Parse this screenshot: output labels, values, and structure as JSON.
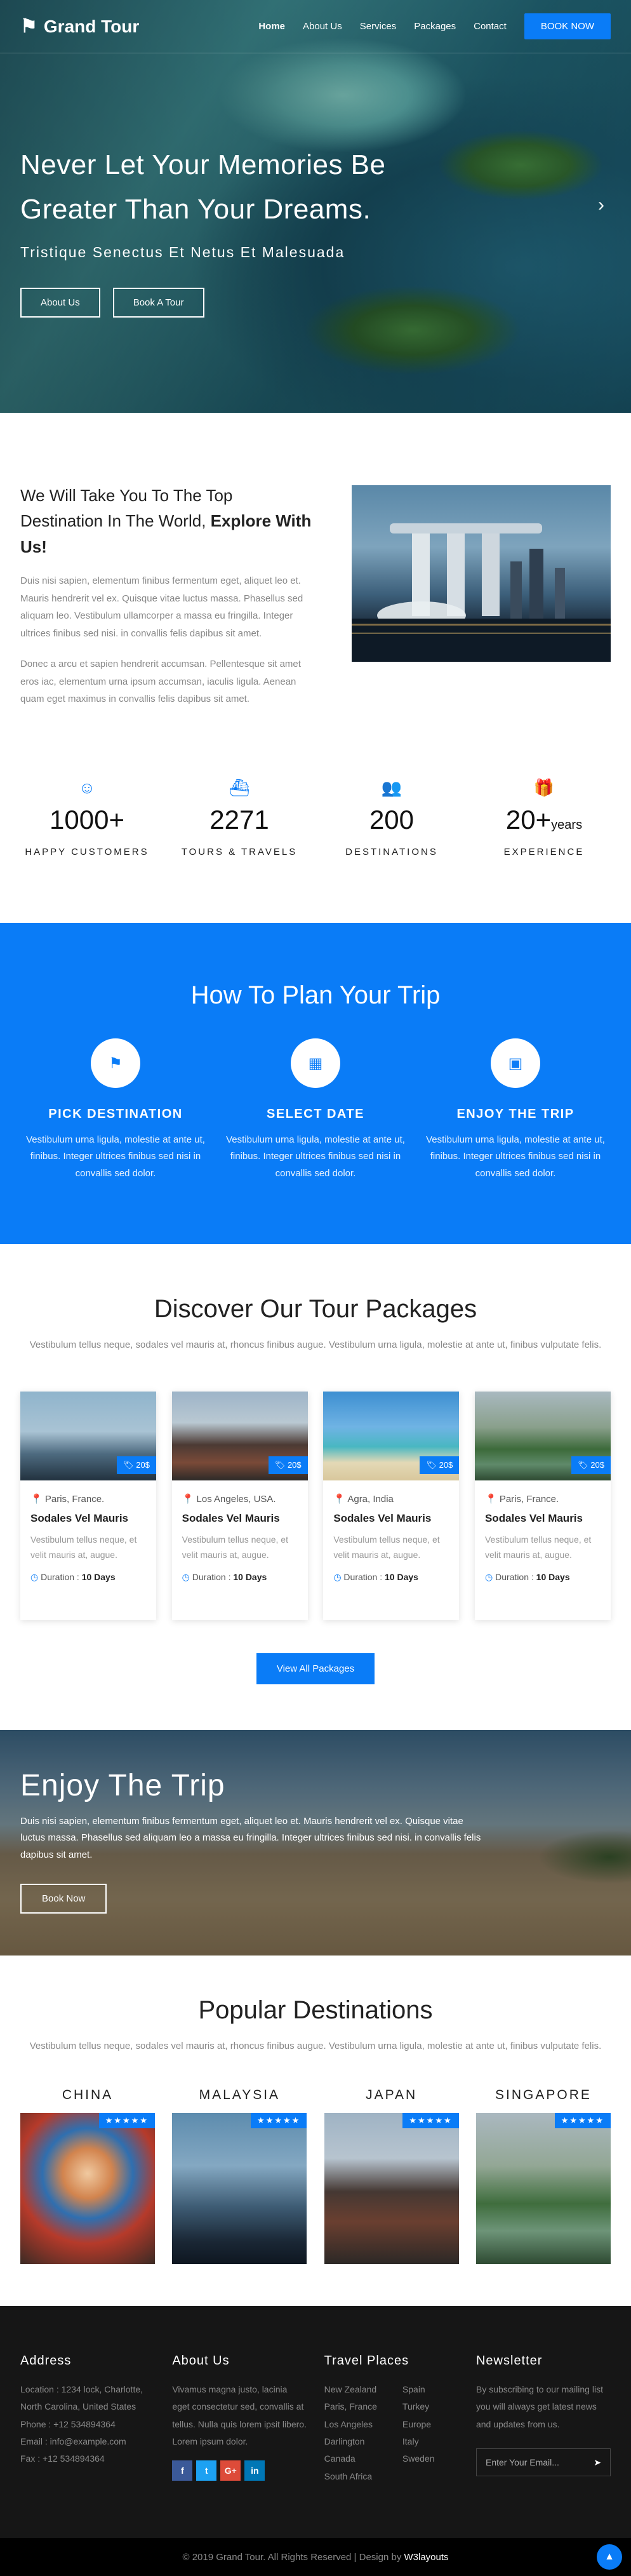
{
  "nav": {
    "brand": "Grand Tour",
    "links": [
      "Home",
      "About Us",
      "Services",
      "Packages",
      "Contact"
    ],
    "book_label": "BOOK NOW"
  },
  "hero": {
    "title_line1": "Never Let Your Memories Be",
    "title_line2": "Greater Than Your Dreams.",
    "subtitle": "Tristique Senectus Et Netus Et Malesuada",
    "about_btn": "About Us",
    "book_btn": "Book A Tour",
    "arrow": "›"
  },
  "about": {
    "heading": "We Will Take You To The Top Destination In The World,",
    "heading_bold": "Explore With Us!",
    "para1": "Duis nisi sapien, elementum finibus fermentum eget, aliquet leo et. Mauris hendrerit vel ex. Quisque vitae luctus massa. Phasellus sed aliquam leo. Vestibulum ullamcorper a massa eu fringilla. Integer ultrices finibus sed nisi. in convallis felis dapibus sit amet.",
    "para2": "Donec a arcu et sapien hendrerit accumsan. Pellentesque sit amet eros iac, elementum urna ipsum accumsan, iaculis ligula. Aenean quam eget maximus in convallis felis dapibus sit amet."
  },
  "stats": [
    {
      "icon": "☺",
      "value": "1000+",
      "suffix": "",
      "label": "HAPPY CUSTOMERS"
    },
    {
      "icon": "⛴",
      "value": "2271",
      "suffix": "",
      "label": "TOURS & TRAVELS"
    },
    {
      "icon": "👥",
      "value": "200",
      "suffix": "",
      "label": "DESTINATIONS"
    },
    {
      "icon": "🎁",
      "value": "20+",
      "suffix": "years",
      "label": "EXPERIENCE"
    }
  ],
  "plan": {
    "title": "How To Plan Your Trip",
    "steps": [
      {
        "icon": "⚑",
        "title": "PICK DESTINATION",
        "text": "Vestibulum urna ligula, molestie at ante ut, finibus. Integer ultrices finibus sed nisi in convallis sed dolor."
      },
      {
        "icon": "▦",
        "title": "SELECT DATE",
        "text": "Vestibulum urna ligula, molestie at ante ut, finibus. Integer ultrices finibus sed nisi in convallis sed dolor."
      },
      {
        "icon": "▣",
        "title": "ENJOY THE TRIP",
        "text": "Vestibulum urna ligula, molestie at ante ut, finibus. Integer ultrices finibus sed nisi in convallis sed dolor."
      }
    ]
  },
  "packages": {
    "title": "Discover Our Tour Packages",
    "subtitle": "Vestibulum tellus neque, sodales vel mauris at, rhoncus finibus augue. Vestibulum urna ligula, molestie at ante ut, finibus vulputate felis.",
    "items": [
      {
        "price": "20$",
        "location": "Paris, France.",
        "title": "Sodales Vel Mauris",
        "text": "Vestibulum tellus neque, et velit mauris at, augue.",
        "duration_label": "Duration :",
        "duration": "10 Days"
      },
      {
        "price": "20$",
        "location": "Los Angeles, USA.",
        "title": "Sodales Vel Mauris",
        "text": "Vestibulum tellus neque, et velit mauris at, augue.",
        "duration_label": "Duration :",
        "duration": "10 Days"
      },
      {
        "price": "20$",
        "location": "Agra, India",
        "title": "Sodales Vel Mauris",
        "text": "Vestibulum tellus neque, et velit mauris at, augue.",
        "duration_label": "Duration :",
        "duration": "10 Days"
      },
      {
        "price": "20$",
        "location": "Paris, France.",
        "title": "Sodales Vel Mauris",
        "text": "Vestibulum tellus neque, et velit mauris at, augue.",
        "duration_label": "Duration :",
        "duration": "10 Days"
      }
    ],
    "view_all": "View All Packages"
  },
  "enjoy": {
    "title": "Enjoy The Trip",
    "text": "Duis nisi sapien, elementum finibus fermentum eget, aliquet leo et. Mauris hendrerit vel ex. Quisque vitae luctus massa. Phasellus sed aliquam leo a massa eu fringilla. Integer ultrices finibus sed nisi. in convallis felis dapibus sit amet.",
    "button": "Book Now"
  },
  "popular": {
    "title": "Popular Destinations",
    "subtitle": "Vestibulum tellus neque, sodales vel mauris at, rhoncus finibus augue. Vestibulum urna ligula, molestie at ante ut, finibus vulputate felis.",
    "items": [
      {
        "name": "CHINA",
        "stars": "★★★★★"
      },
      {
        "name": "MALAYSIA",
        "stars": "★★★★★"
      },
      {
        "name": "JAPAN",
        "stars": "★★★★★"
      },
      {
        "name": "SINGAPORE",
        "stars": "★★★★★"
      }
    ]
  },
  "footer": {
    "address_title": "Address",
    "address": "Location : 1234 lock, Charlotte, North Carolina, United States",
    "phone": "Phone : +12 534894364",
    "email": "Email : info@example.com",
    "fax": "Fax : +12 534894364",
    "about_title": "About Us",
    "about_text": "Vivamus magna justo, lacinia eget consectetur sed, convallis at tellus. Nulla quis lorem ipsit libero. Lorem ipsum dolor.",
    "social": [
      "f",
      "t",
      "G+",
      "in"
    ],
    "places_title": "Travel Places",
    "places_col1": [
      "New Zealand",
      "Paris, France",
      "Los Angeles",
      "Darlington",
      "Canada",
      "South Africa"
    ],
    "places_col2": [
      "Spain",
      "Turkey",
      "Europe",
      "Italy",
      "Sweden"
    ],
    "newsletter_title": "Newsletter",
    "newsletter_text": "By subscribing to our mailing list you will always get latest news and updates from us.",
    "email_placeholder": "Enter Your Email...",
    "send_icon": "➤"
  },
  "copyright": {
    "text": "© 2019 Grand Tour. All Rights Reserved | Design by",
    "brand": "W3layouts",
    "to_top": "▲"
  },
  "colors": {
    "accent": "#0a7cf7",
    "footer_bg": "#161616"
  }
}
